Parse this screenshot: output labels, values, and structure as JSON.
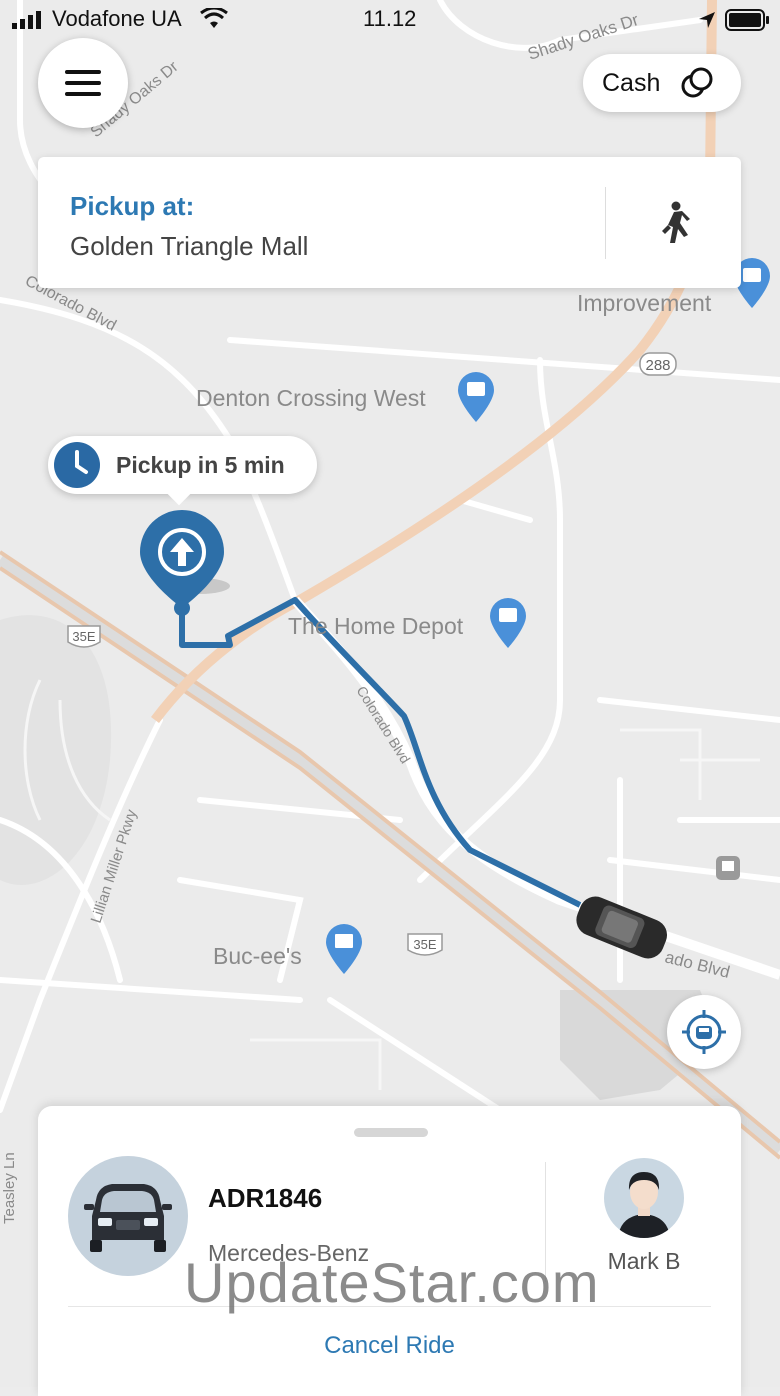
{
  "status_bar": {
    "carrier": "Vodafone UA",
    "time": "11.12"
  },
  "map": {
    "labels": {
      "shady_oaks": "Shady Oaks Dr",
      "colorado_blvd_nw": "Colorado Blvd",
      "improvement": "Improvement",
      "route_288": "288",
      "denton_crossing": "Denton Crossing West",
      "home_depot": "The Home Depot",
      "hwy_35e_1": "35E",
      "colorado_blvd_route": "Colorado Blvd",
      "lillian_miller": "Lillian Miller Pkwy",
      "bucees": "Buc-ee's",
      "hwy_35e_2": "35E",
      "colorado_blvd_se": "ado Blvd",
      "teasley": "Teasley Ln"
    },
    "route_color": "#2d6fa8",
    "icons": [
      "shopping-bag-pin",
      "car-icon",
      "pickup-pin"
    ]
  },
  "header": {
    "payment_label": "Cash"
  },
  "pickup": {
    "title": "Pickup at:",
    "place": "Golden Triangle Mall"
  },
  "eta": {
    "label": "Pickup in 5 min"
  },
  "ride": {
    "plate": "ADR1846",
    "model": "Mercedes-Benz",
    "driver": "Mark B",
    "cancel_label": "Cancel Ride"
  },
  "watermark": "UpdateStar.com"
}
